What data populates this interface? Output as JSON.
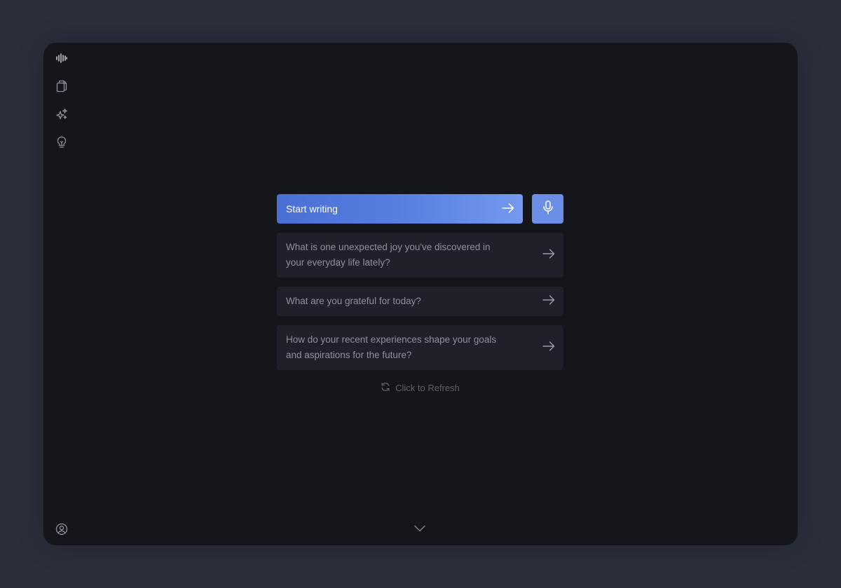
{
  "sidebar": {
    "items": [
      {
        "icon": "waveform-icon"
      },
      {
        "icon": "documents-icon"
      },
      {
        "icon": "sparkles-icon"
      },
      {
        "icon": "lightbulb-icon"
      }
    ],
    "footer_icon": "user-circle-icon"
  },
  "composer": {
    "start_label": "Start writing",
    "mic_icon": "microphone-icon"
  },
  "prompts": [
    {
      "text": "What is one unexpected joy you've discovered in your everyday life lately?"
    },
    {
      "text": "What are you grateful for today?"
    },
    {
      "text": "How do your recent experiences shape your goals and aspirations for the future?"
    }
  ],
  "refresh": {
    "label": "Click to Refresh"
  },
  "colors": {
    "page_bg": "#2b2e3b",
    "window_bg": "#15161c",
    "accent_start": "#4a6fd6",
    "accent_end": "#7499ee",
    "card_bg": "#1f2029"
  }
}
